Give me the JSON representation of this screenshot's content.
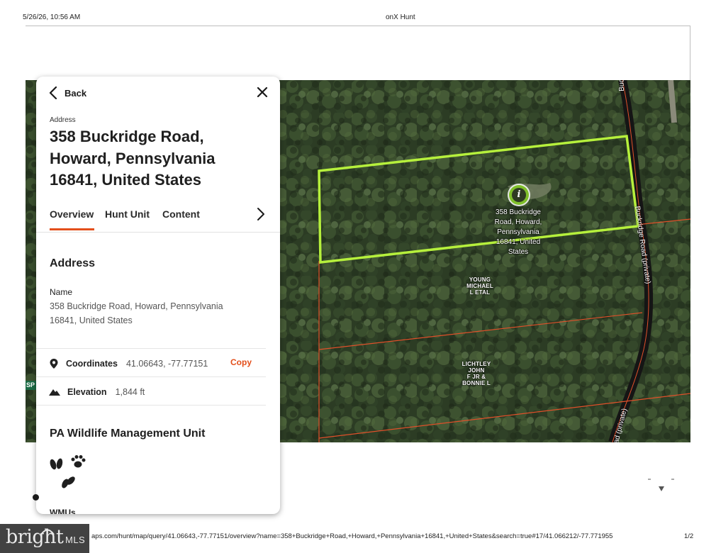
{
  "print_header": {
    "datetime": "5/26/26, 10:56 AM",
    "title": "onX Hunt"
  },
  "map": {
    "road_label_top": "Buckridge Road (private)",
    "road_label_side": "Buckridge Road (private)",
    "road_label_bottom": "ad (private)",
    "sp_badge": "SP",
    "pin_label_lines": [
      "358 Buckridge",
      "Road, Howard,",
      "Pennsylvania",
      "16841, United",
      "States"
    ],
    "parcels": [
      {
        "lines": [
          "YOUNG",
          "MICHAEL",
          "L ETAL"
        ]
      },
      {
        "lines": [
          "LICHTLEY",
          "JOHN",
          "F JR &",
          "BONNIE L"
        ]
      }
    ],
    "colors": {
      "parcel_boundary": "#e0502a",
      "selected_parcel": "#b6f03c",
      "pin": "#7fbf2a"
    },
    "pin_icon": "info-icon"
  },
  "panel": {
    "back_label": "Back",
    "address_caption": "Address",
    "address_title": "358 Buckridge Road, Howard, Pennsylvania 16841, United States",
    "tabs": [
      {
        "label": "Overview",
        "active": true
      },
      {
        "label": "Hunt Unit",
        "active": false
      },
      {
        "label": "Content",
        "active": false
      }
    ],
    "section_address": "Address",
    "name_label": "Name",
    "name_value": "358 Buckridge Road, Howard, Pennsylvania 16841, United States",
    "coordinates_label": "Coordinates",
    "coordinates_value": "41.06643, -77.77151",
    "copy_label": "Copy",
    "elevation_label": "Elevation",
    "elevation_value": "1,844 ft",
    "section_wmu": "PA Wildlife Management Unit",
    "wmus_label": "WMUs",
    "accent_color": "#e34f1b"
  },
  "footer": {
    "url": "aps.com/hunt/map/query/41.06643,-77.77151/overview?name=358+Buckridge+Road,+Howard,+Pennsylvania+16841,+United+States&search=true#17/41.066212/-77.771955",
    "page": "1/2",
    "watermark_brand": "bright",
    "watermark_mls": "MLS"
  }
}
